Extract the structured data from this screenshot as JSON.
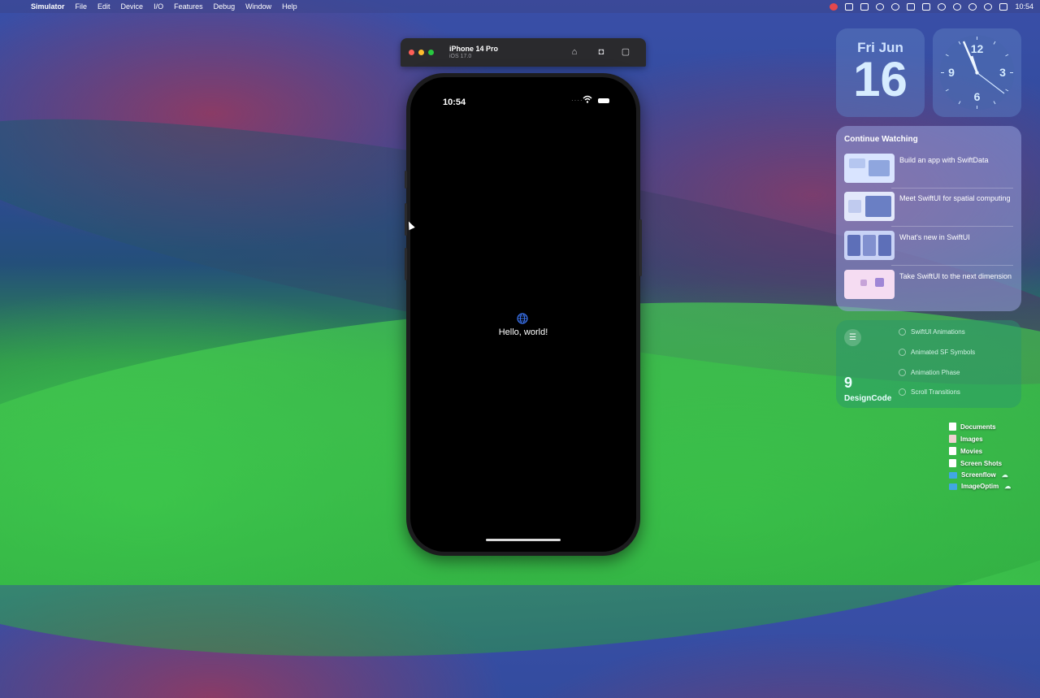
{
  "menubar": {
    "app_name": "Simulator",
    "items": [
      "File",
      "Edit",
      "Device",
      "I/O",
      "Features",
      "Debug",
      "Window",
      "Help"
    ],
    "clock": "10:54"
  },
  "simulator": {
    "device_name": "iPhone 14 Pro",
    "os_version": "iOS 17.0"
  },
  "phone": {
    "status_time": "10:54",
    "content_text": "Hello, world!",
    "icon": "globe-icon"
  },
  "widgets": {
    "date": {
      "day_month": "Fri Jun",
      "day_number": "16"
    },
    "clock": {
      "numerals": [
        "12",
        "3",
        "6",
        "9"
      ]
    },
    "continue_watching": {
      "title": "Continue Watching",
      "items": [
        "Build an app with SwiftData",
        "Meet SwiftUI for spatial computing",
        "What's new in SwiftUI",
        "Take SwiftUI to the next dimension"
      ]
    },
    "designcode": {
      "count": "9",
      "name": "DesignCode",
      "items": [
        "SwiftUI Animations",
        "Animated SF Symbols",
        "Animation Phase",
        "Scroll Transitions"
      ]
    }
  },
  "desktop_items": [
    "Documents",
    "Images",
    "Movies",
    "Screen Shots",
    "Screenflow",
    "ImageOptim"
  ]
}
